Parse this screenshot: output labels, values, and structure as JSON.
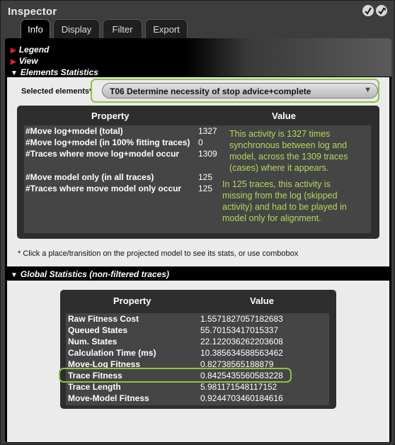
{
  "window": {
    "title": "Inspector"
  },
  "tabs": [
    {
      "label": "Info",
      "active": true
    },
    {
      "label": "Display",
      "active": false
    },
    {
      "label": "Filter",
      "active": false
    },
    {
      "label": "Export",
      "active": false
    }
  ],
  "sections": {
    "legend": "Legend",
    "view": "View",
    "elements_statistics": "Elements Statistics",
    "global_statistics": "Global Statistics (non-filtered traces)"
  },
  "selected_elements": {
    "label": "Selected elements",
    "value": "T06 Determine necessity of stop advice+complete"
  },
  "element_table": {
    "headers": {
      "property": "Property",
      "value": "Value"
    },
    "rows": [
      {
        "property": "#Move log+model (total)",
        "value": "1327"
      },
      {
        "property": "#Move log+model (in 100% fitting traces)",
        "value": "0"
      },
      {
        "property": "#Traces where move log+model occur",
        "value": "1309"
      },
      {
        "property": "#Move model only (in all traces)",
        "value": "125"
      },
      {
        "property": "#Traces where move model only occur",
        "value": "125"
      }
    ],
    "note1": "This activity is 1327 times synchronous between log and model, across the 1309 traces (cases) where it appears.",
    "note2": "In 125 traces, this activity is missing from the log (skipped activity) and had to be played in model only for alignment."
  },
  "hint": "* Click a place/transition on the projected model to see its stats, or use combobox",
  "global_table": {
    "headers": {
      "property": "Property",
      "value": "Value"
    },
    "rows": [
      {
        "property": "Raw Fitness Cost",
        "value": "1.5571827057182683"
      },
      {
        "property": "Queued States",
        "value": "55.70153417015337"
      },
      {
        "property": "Num. States",
        "value": "22.122036262203608"
      },
      {
        "property": "Calculation Time (ms)",
        "value": "10.385634588563462"
      },
      {
        "property": "Move-Log Fitness",
        "value": "0.82738565188879"
      },
      {
        "property": "Trace Fitness",
        "value": "0.8425435560583228"
      },
      {
        "property": "Trace Length",
        "value": "5.981171548117152"
      },
      {
        "property": "Move-Model Fitness",
        "value": "0.9244703460184616"
      }
    ]
  },
  "colors": {
    "highlight": "#8dc63f",
    "note_text": "#b3d95a",
    "panel_bg": "#ebebeb",
    "legend_arrow": "#e0202a"
  }
}
